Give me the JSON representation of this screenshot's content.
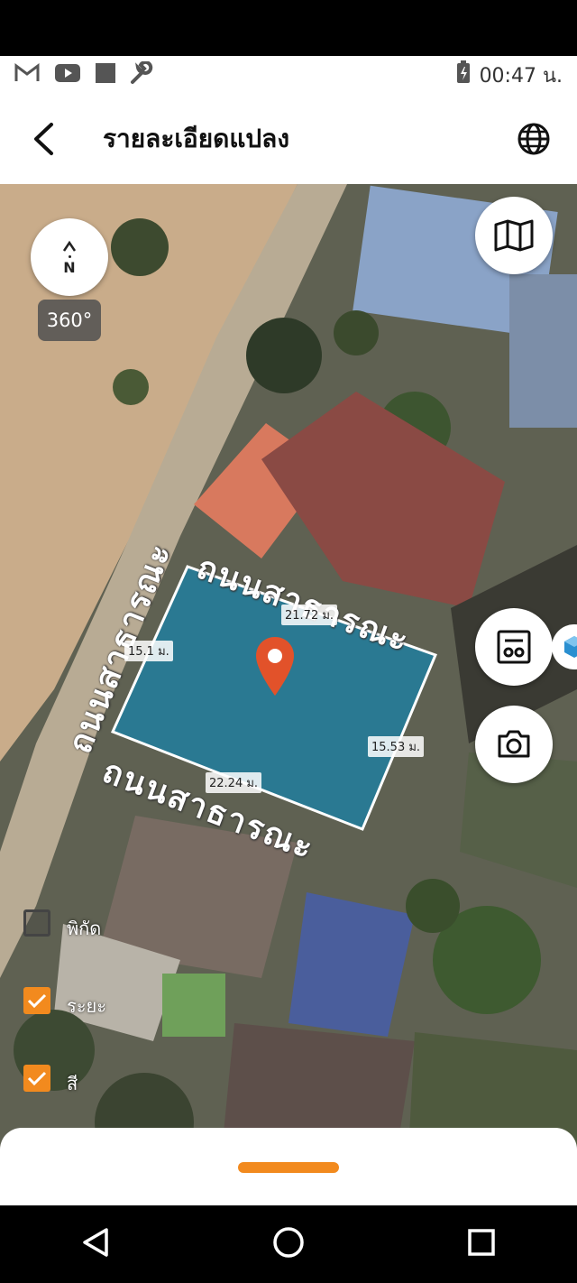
{
  "status": {
    "time": "00:47 น.",
    "left_icons": [
      "gmail-icon",
      "youtube-icon",
      "square-icon",
      "wrench-icon"
    ],
    "battery_icon": "battery-charging-icon"
  },
  "header": {
    "title": "รายละเอียดแปลง",
    "back_icon": "chevron-left-icon",
    "language_icon": "globe-icon"
  },
  "map": {
    "compass_label": "N",
    "view_360_label": "360°",
    "road_label": "ถนนสาธารณะ",
    "dimensions": {
      "top": "21.72 ม.",
      "left": "15.1 ม.",
      "right": "15.53 ม.",
      "bottom": "22.24 ม."
    },
    "parcel_fill_color": "#1f7fa0",
    "pin_color": "#e2522a"
  },
  "controls": [
    {
      "label": "พิกัด",
      "checked": false
    },
    {
      "label": "ระยะ",
      "checked": true
    },
    {
      "label": "สี",
      "checked": true
    }
  ],
  "accent_color": "#f28a1e",
  "nav": [
    "back-icon",
    "home-icon",
    "recents-icon"
  ]
}
